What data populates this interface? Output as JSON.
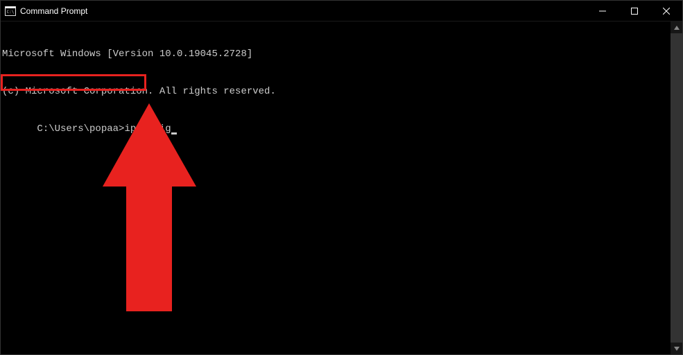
{
  "window": {
    "title": "Command Prompt"
  },
  "terminal": {
    "banner_line1": "Microsoft Windows [Version 10.0.19045.2728]",
    "banner_line2": "(c) Microsoft Corporation. All rights reserved.",
    "prompt": "C:\\Users\\popaa>",
    "command": "ipconfig"
  },
  "annotation": {
    "highlight_color": "#e8221f",
    "arrow_color": "#e8221f"
  }
}
